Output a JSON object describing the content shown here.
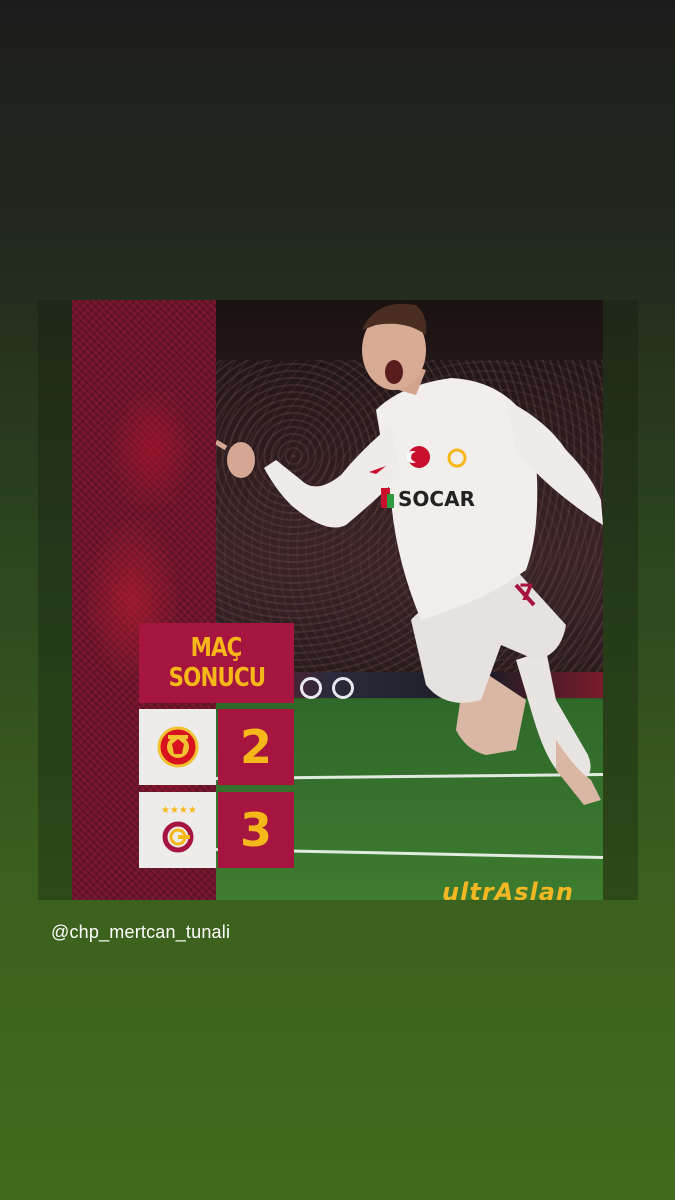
{
  "story": {
    "handle": "@chp_mertcan_tunali"
  },
  "post": {
    "title_line1": "MAÇ",
    "title_line2": "SONUCU",
    "matches": [
      {
        "team": "Manchester United",
        "crest_icon": "manchester-united-crest-icon",
        "score": "2"
      },
      {
        "team": "Galatasaray",
        "crest_icon": "galatasaray-crest-icon",
        "score": "3"
      }
    ],
    "jersey_sponsor": "SOCAR",
    "watermark": "ultrAslan"
  },
  "colors": {
    "accent_red": "#a6153f",
    "accent_yellow": "#f5b818",
    "background_green": "#426b1e"
  }
}
